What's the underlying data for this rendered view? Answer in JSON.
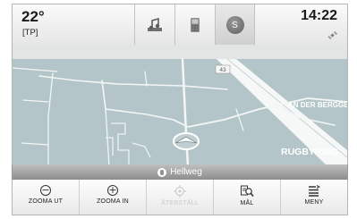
{
  "status": {
    "temperature": "22°",
    "traffic_program": "[TP]",
    "time": "14:22",
    "source_badge": "S"
  },
  "tiles": [
    {
      "icon": "music-icon"
    },
    {
      "icon": "phone-icon"
    },
    {
      "icon": "navigation-source-icon",
      "active": true
    }
  ],
  "map": {
    "road_number": "43",
    "street_label_1": "AN DER BERGGE",
    "street_label_2": "RUGBYRING"
  },
  "current_street": "Hellweg",
  "bottom_menu": [
    {
      "label": "ZOOMA UT",
      "icon": "zoom-out-icon"
    },
    {
      "label": "ZOOMA IN",
      "icon": "zoom-in-icon"
    },
    {
      "label": "ÅTERSTÄLL",
      "icon": "recenter-icon",
      "disabled": true
    },
    {
      "label": "MÅL",
      "icon": "destination-search-icon"
    },
    {
      "label": "MENY",
      "icon": "menu-icon"
    }
  ]
}
